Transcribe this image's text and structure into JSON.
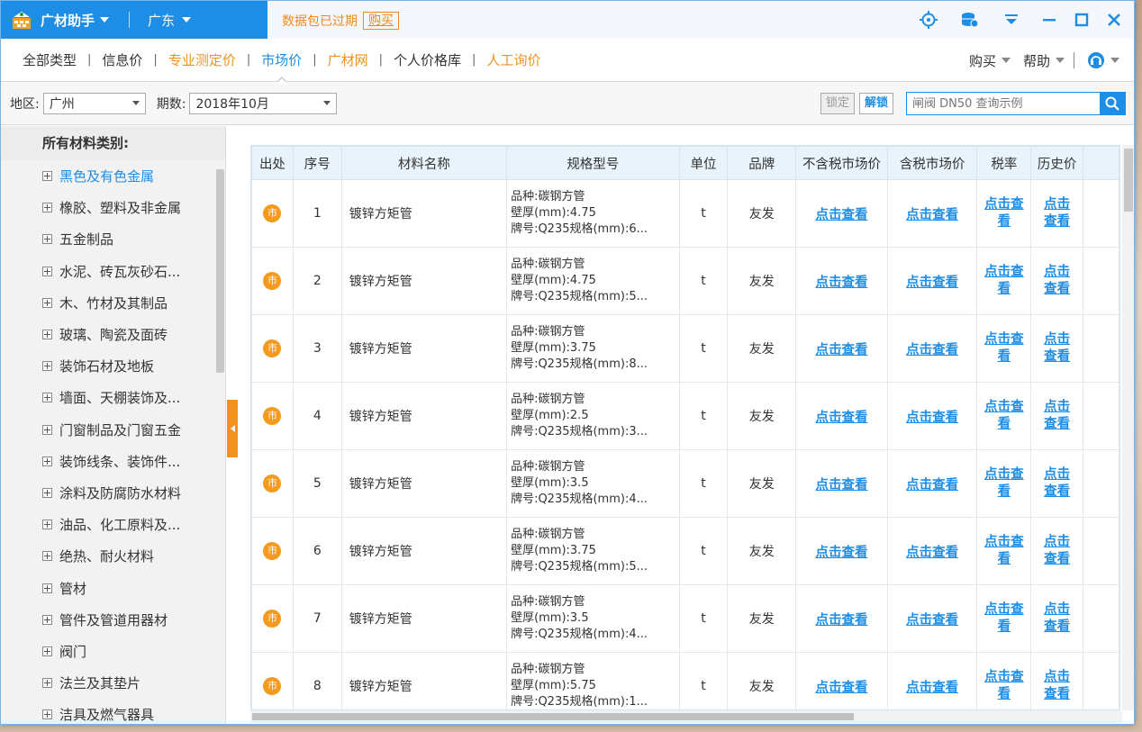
{
  "titlebar": {
    "app_name": "广材助手",
    "region": "广东",
    "notice": "数据包已过期",
    "buy_link": "购买"
  },
  "nav": {
    "tabs": [
      {
        "label": "全部类型",
        "style": "normal"
      },
      {
        "label": "信息价",
        "style": "normal"
      },
      {
        "label": "专业测定价",
        "style": "orange"
      },
      {
        "label": "市场价",
        "style": "active"
      },
      {
        "label": "广材网",
        "style": "orange"
      },
      {
        "label": "个人价格库",
        "style": "normal"
      },
      {
        "label": "人工询价",
        "style": "orange"
      }
    ],
    "separator": "|",
    "buy": "购买",
    "help": "帮助"
  },
  "filter": {
    "region_label": "地区:",
    "region_value": "广州",
    "period_label": "期数:",
    "period_value": "2018年10月",
    "lock": "锁定",
    "unlock": "解锁",
    "search_placeholder": "闸阀 DN50 查询示例"
  },
  "sidebar": {
    "title": "所有材料类别:",
    "items": [
      "黑色及有色金属",
      "橡胶、塑料及非金属",
      "五金制品",
      "水泥、砖瓦灰砂石...",
      "木、竹材及其制品",
      "玻璃、陶瓷及面砖",
      "装饰石材及地板",
      "墙面、天棚装饰及...",
      "门窗制品及门窗五金",
      "装饰线条、装饰件...",
      "涂料及防腐防水材料",
      "油品、化工原料及...",
      "绝热、耐火材料",
      "管材",
      "管件及管道用器材",
      "阀门",
      "法兰及其垫片",
      "洁具及燃气器具"
    ]
  },
  "table": {
    "headers": [
      "出处",
      "序号",
      "材料名称",
      "规格型号",
      "单位",
      "品牌",
      "不含税市场价",
      "含税市场价",
      "税率",
      "历史价"
    ],
    "source_badge": "市",
    "view_link": "点击查看",
    "tax_link_1": "点击查",
    "tax_link_2": "看",
    "hist_link_1": "点击",
    "hist_link_2": "查看",
    "rows": [
      {
        "no": "1",
        "name": "镀锌方矩管",
        "spec1": "品种:碳钢方管",
        "spec2": "壁厚(mm):4.75",
        "spec3": "牌号:Q235规格(mm):6...",
        "unit": "t",
        "brand": "友发"
      },
      {
        "no": "2",
        "name": "镀锌方矩管",
        "spec1": "品种:碳钢方管",
        "spec2": "壁厚(mm):4.75",
        "spec3": "牌号:Q235规格(mm):5...",
        "unit": "t",
        "brand": "友发"
      },
      {
        "no": "3",
        "name": "镀锌方矩管",
        "spec1": "品种:碳钢方管",
        "spec2": "壁厚(mm):3.75",
        "spec3": "牌号:Q235规格(mm):8...",
        "unit": "t",
        "brand": "友发"
      },
      {
        "no": "4",
        "name": "镀锌方矩管",
        "spec1": "品种:碳钢方管",
        "spec2": "壁厚(mm):2.5",
        "spec3": "牌号:Q235规格(mm):3...",
        "unit": "t",
        "brand": "友发"
      },
      {
        "no": "5",
        "name": "镀锌方矩管",
        "spec1": "品种:碳钢方管",
        "spec2": "壁厚(mm):3.5",
        "spec3": "牌号:Q235规格(mm):4...",
        "unit": "t",
        "brand": "友发"
      },
      {
        "no": "6",
        "name": "镀锌方矩管",
        "spec1": "品种:碳钢方管",
        "spec2": "壁厚(mm):3.75",
        "spec3": "牌号:Q235规格(mm):5...",
        "unit": "t",
        "brand": "友发"
      },
      {
        "no": "7",
        "name": "镀锌方矩管",
        "spec1": "品种:碳钢方管",
        "spec2": "壁厚(mm):3.5",
        "spec3": "牌号:Q235规格(mm):4...",
        "unit": "t",
        "brand": "友发"
      },
      {
        "no": "8",
        "name": "镀锌方矩管",
        "spec1": "品种:碳钢方管",
        "spec2": "壁厚(mm):5.75",
        "spec3": "牌号:Q235规格(mm):1...",
        "unit": "t",
        "brand": "友发"
      }
    ]
  },
  "colors": {
    "accent": "#1e8de6",
    "orange": "#f0921f"
  }
}
